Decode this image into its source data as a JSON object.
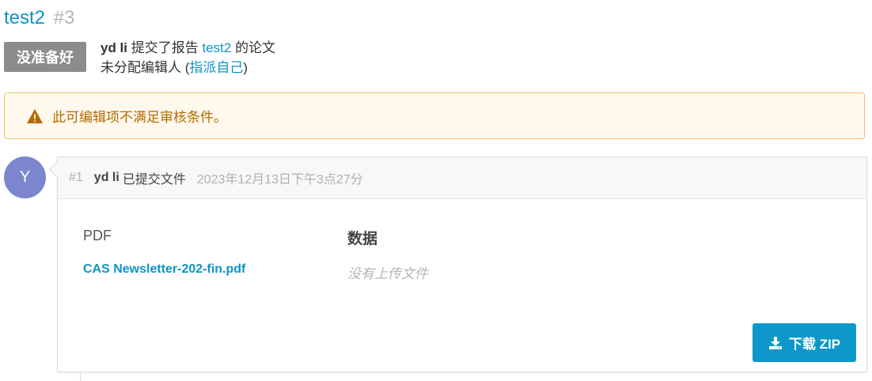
{
  "header": {
    "title": "test2",
    "number": "#3"
  },
  "status": {
    "badge": "没准备好"
  },
  "submission": {
    "user": "yd li",
    "action": "提交了报告",
    "report_link": "test2",
    "suffix": "的论文",
    "editor_text": "未分配编辑人 (",
    "assign_link": "指派自己",
    "editor_close": ")"
  },
  "alert": {
    "message": "此可编辑项不满足审核条件。",
    "icon": "warning-icon",
    "color": "#b36b00"
  },
  "timeline": {
    "avatar_letter": "Y",
    "avatar_color": "#7b86cf",
    "entry_number": "#1",
    "user": "yd li",
    "action": "已提交文件",
    "timestamp": "2023年12月13日下午3点27分",
    "columns": {
      "pdf": "PDF",
      "data": "数据"
    },
    "pdf_file": "CAS Newsletter-202-fin.pdf",
    "no_data_files": "没有上传文件",
    "download_button": "下载 ZIP",
    "button_color": "#0e98c9"
  }
}
